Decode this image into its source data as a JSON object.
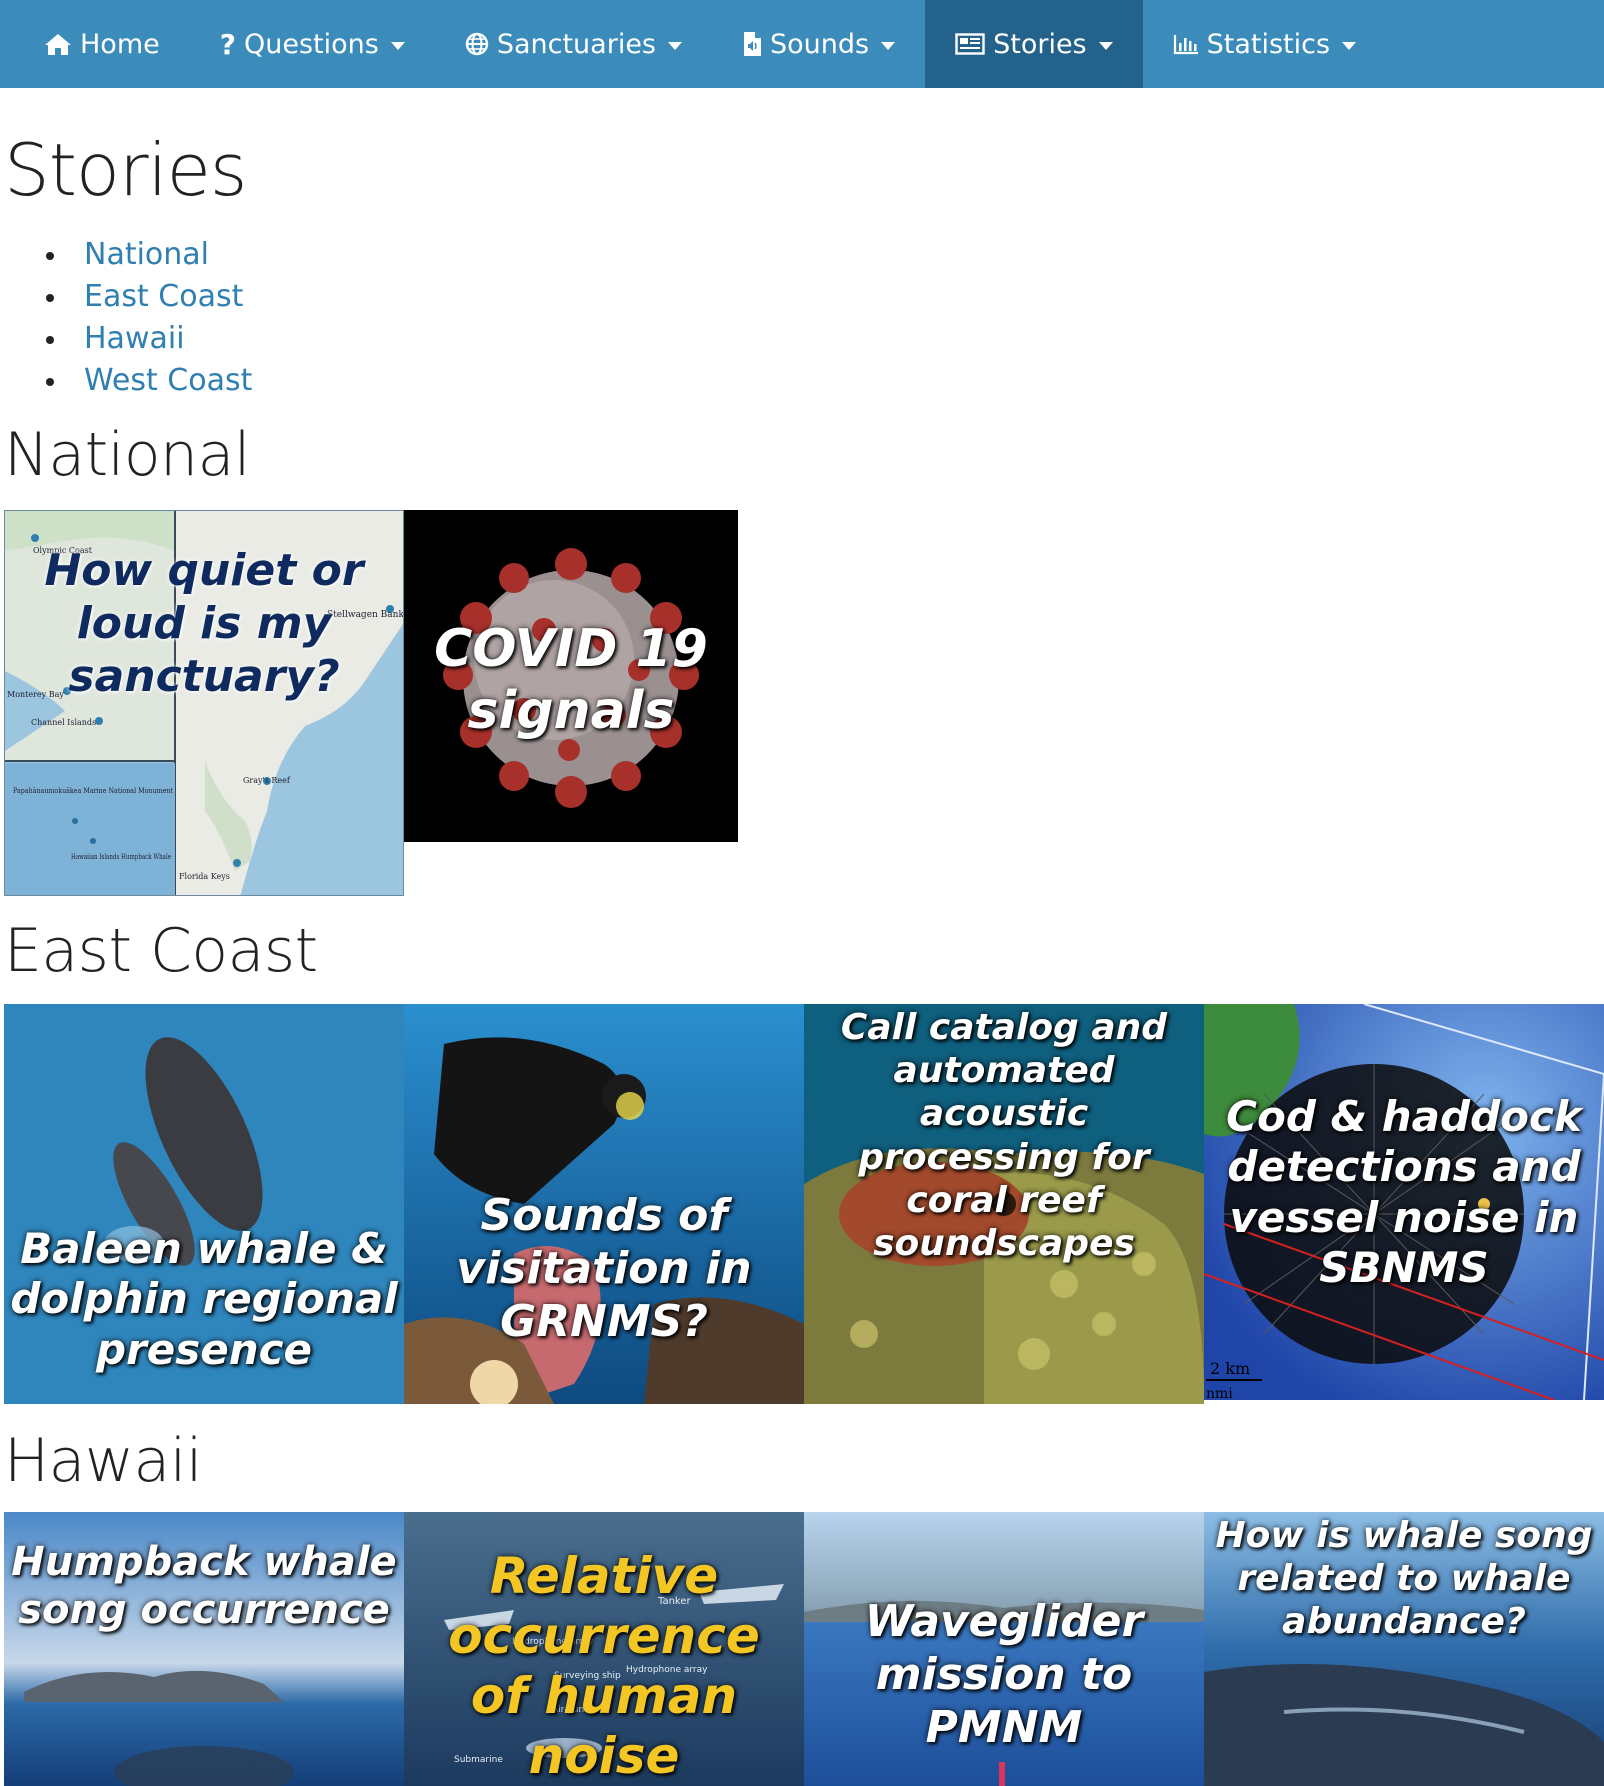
{
  "nav": {
    "items": [
      {
        "label": "Home",
        "icon": "home-icon"
      },
      {
        "label": "Questions",
        "icon": "question-icon",
        "caret": true
      },
      {
        "label": "Sanctuaries",
        "icon": "globe-icon",
        "caret": true
      },
      {
        "label": "Sounds",
        "icon": "audio-file-icon",
        "caret": true
      },
      {
        "label": "Stories",
        "icon": "newspaper-icon",
        "caret": true,
        "active": true
      },
      {
        "label": "Statistics",
        "icon": "bar-chart-icon",
        "caret": true
      }
    ],
    "bg": "#3b8bbb",
    "active_bg": "#23628a"
  },
  "page": {
    "title": "Stories"
  },
  "toc": [
    "National",
    "East Coast",
    "Hawaii",
    "West Coast"
  ],
  "sections": {
    "national": {
      "heading": "National",
      "tiles": [
        {
          "caption": "How quiet or loud is my sanctuary?"
        },
        {
          "caption": "COVID 19 signals"
        }
      ]
    },
    "east_coast": {
      "heading": "East Coast",
      "tiles": [
        {
          "caption": "Baleen whale & dolphin regional presence"
        },
        {
          "caption": "Sounds of visitation in GRNMS?"
        },
        {
          "caption": "Call catalog and automated acoustic processing for coral reef soundscapes"
        },
        {
          "caption": "Cod & haddock detections and vessel noise in SBNMS"
        }
      ]
    },
    "hawaii": {
      "heading": "Hawaii",
      "tiles": [
        {
          "caption": "Humpback whale song occurrence"
        },
        {
          "caption": "Relative occurrence of human noise"
        },
        {
          "caption": "Waveglider mission to PMNM"
        },
        {
          "caption": "How is whale song related to whale abundance?"
        }
      ]
    }
  },
  "map_labels": {
    "olympic": "Olympic Coast",
    "stellwagen": "Stellwagen Bank",
    "monterey": "Monterey Bay",
    "channel": "Channel Islands",
    "grays": "Gray's Reef",
    "papa": "Papahānaumokuākea Marine National Monument",
    "hihwnms": "Hawaiian Islands Humpback Whale",
    "florida": "Florida Keys"
  },
  "scale_labels": {
    "km": "2 km",
    "nmi": "nmi"
  },
  "noise_labels": [
    "Tanker",
    "Hydrophone array",
    "Surveying ship",
    "Hydrophone array",
    "Air-gun array",
    "Submarine"
  ]
}
